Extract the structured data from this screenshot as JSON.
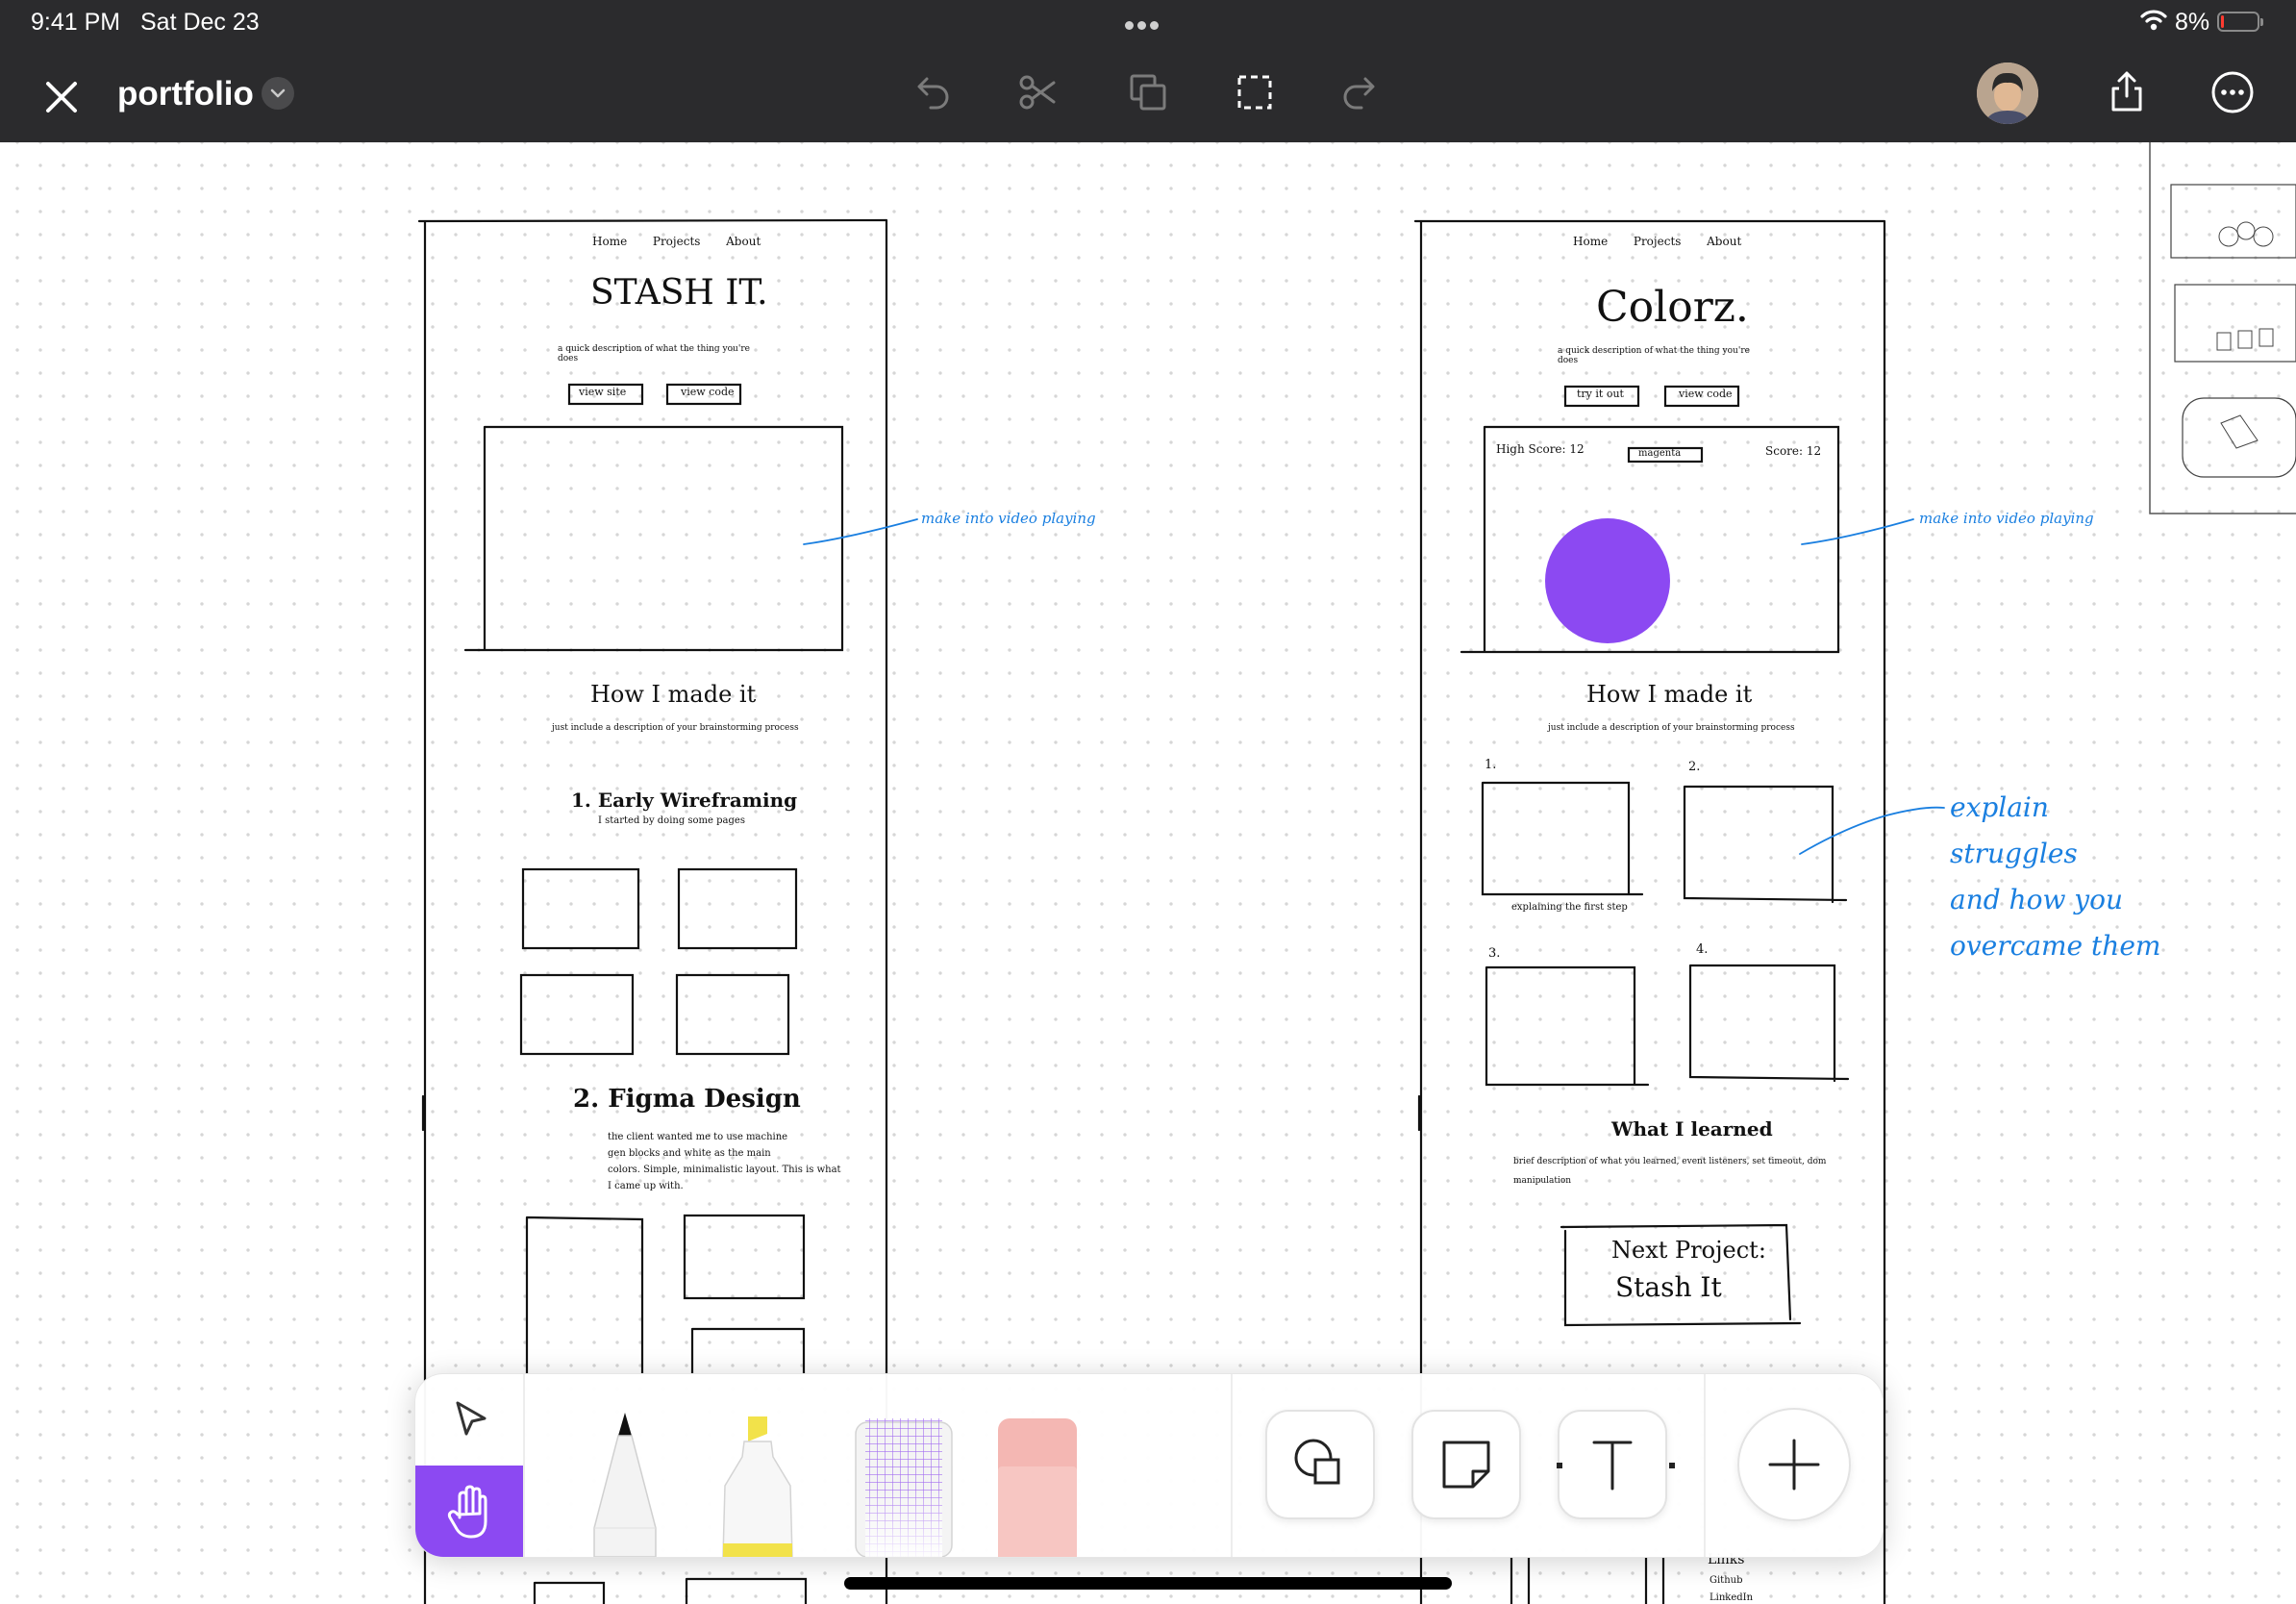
{
  "status_bar": {
    "time": "9:41 PM",
    "date": "Sat Dec 23",
    "battery": "8%",
    "battery_level": 0.08
  },
  "toolbar": {
    "title": "portfolio",
    "icons": [
      "close-icon",
      "chevron-down-icon",
      "undo-icon",
      "scissors-icon",
      "duplicate-icon",
      "selection-icon",
      "redo-icon",
      "avatar",
      "share-icon",
      "more-icon"
    ]
  },
  "board": {
    "stash": {
      "nav": [
        "Home",
        "Projects",
        "About"
      ],
      "title": "STASH IT.",
      "desc": "a quick description of what the thing you're does",
      "buttons": [
        "view site",
        "view code"
      ],
      "note": "make into video playing",
      "how_title": "How I made it",
      "how_sub": "just include a description of your brainstorming process",
      "step1_title": "1. Early Wireframing",
      "step1_desc": "I started by doing some pages",
      "step2_title": "2. Figma Design",
      "step2_desc": [
        "the client wanted me to use machine",
        "gen blocks and white as the main",
        "colors. Simple, minimalistic layout. This is what",
        "I came up with."
      ]
    },
    "colorz": {
      "nav": [
        "Home",
        "Projects",
        "About"
      ],
      "title": "Colorz.",
      "desc": "a quick description of what the thing you're does",
      "buttons": [
        "try it out",
        "view code"
      ],
      "high_score": "High Score: 12",
      "color_word": "magenta",
      "score": "Score: 12",
      "note": "make into video playing",
      "how_title": "How I made it",
      "how_sub": "just include a description of your brainstorming process",
      "step_numbers": [
        "1.",
        "2.",
        "3.",
        "4."
      ],
      "step_caption": "explaining the first step",
      "struggles_note": [
        "explain",
        "struggles",
        "and how you",
        "overcame them"
      ],
      "learned_title": "What I learned",
      "learned_desc": [
        "brief description of what you learned, event listeners, set timeout, dom",
        "manipulation"
      ],
      "next_label": "Next Project:",
      "next_name": "Stash It",
      "footer": [
        "Links",
        "Github",
        "LinkedIn"
      ]
    },
    "accent_color": "#8c49f2",
    "note_color": "#1a7fe0"
  },
  "palette": {
    "tools": [
      "select-tool",
      "hand-tool",
      "pen-tool",
      "highlighter-tool",
      "pattern-tool",
      "eraser-tool",
      "shape-tool",
      "sticky-note-tool",
      "text-tool",
      "add-tool"
    ],
    "active": "hand-tool"
  }
}
